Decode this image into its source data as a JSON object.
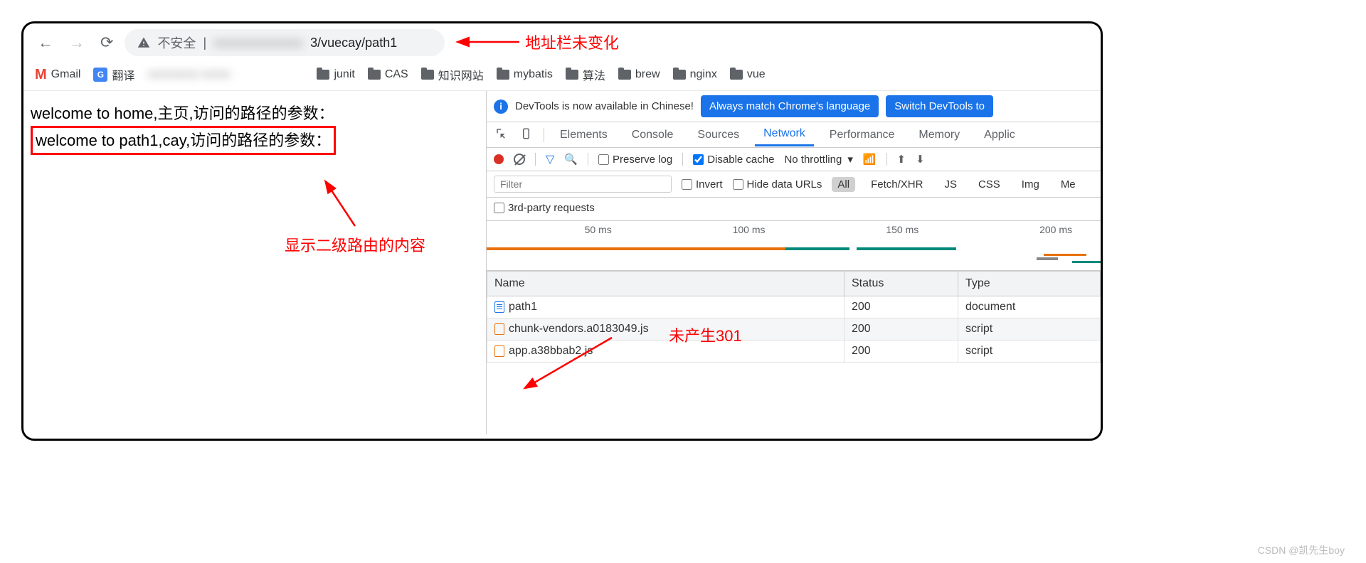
{
  "address_bar": {
    "security_label": "不安全",
    "url_visible": "3/vuecay/path1"
  },
  "bookmarks": [
    {
      "icon": "gmail",
      "label": "Gmail"
    },
    {
      "icon": "gtranslate",
      "label": "翻译"
    },
    {
      "icon": "blur",
      "label": ""
    },
    {
      "icon": "folder",
      "label": "junit"
    },
    {
      "icon": "folder",
      "label": "CAS"
    },
    {
      "icon": "folder",
      "label": "知识网站"
    },
    {
      "icon": "folder",
      "label": "mybatis"
    },
    {
      "icon": "folder",
      "label": "算法"
    },
    {
      "icon": "folder",
      "label": "brew"
    },
    {
      "icon": "folder",
      "label": "nginx"
    },
    {
      "icon": "folder",
      "label": "vue"
    }
  ],
  "page": {
    "line1": "welcome to home,主页,访问的路径的参数：",
    "line2": "welcome to path1,cay,访问的路径的参数："
  },
  "devtools": {
    "info_text": "DevTools is now available in Chinese!",
    "btn_match": "Always match Chrome's language",
    "btn_switch": "Switch DevTools to ",
    "tabs": [
      "Elements",
      "Console",
      "Sources",
      "Network",
      "Performance",
      "Memory",
      "Applic"
    ],
    "active_tab": "Network",
    "preserve_log": "Preserve log",
    "disable_cache": "Disable cache",
    "throttling": "No throttling",
    "filter_placeholder": "Filter",
    "invert": "Invert",
    "hide_urls": "Hide data URLs",
    "type_filters": [
      "All",
      "Fetch/XHR",
      "JS",
      "CSS",
      "Img",
      "Me"
    ],
    "third_party": "3rd-party requests",
    "timeline_marks": [
      "50 ms",
      "100 ms",
      "150 ms",
      "200 ms"
    ],
    "columns": [
      "Name",
      "Status",
      "Type"
    ],
    "rows": [
      {
        "name": "path1",
        "status": "200",
        "type": "document",
        "icon": "doc"
      },
      {
        "name": "chunk-vendors.a0183049.js",
        "status": "200",
        "type": "script",
        "icon": "js"
      },
      {
        "name": "app.a38bbab2.js",
        "status": "200",
        "type": "script",
        "icon": "js"
      }
    ]
  },
  "annotations": {
    "addr": "地址栏未变化",
    "route": "显示二级路由的内容",
    "no301": "未产生301"
  },
  "watermark": "CSDN @凯先生boy",
  "chart_data": {
    "type": "table",
    "title": "Network requests",
    "columns": [
      "Name",
      "Status",
      "Type"
    ],
    "rows": [
      [
        "path1",
        "200",
        "document"
      ],
      [
        "chunk-vendors.a0183049.js",
        "200",
        "script"
      ],
      [
        "app.a38bbab2.js",
        "200",
        "script"
      ]
    ]
  }
}
